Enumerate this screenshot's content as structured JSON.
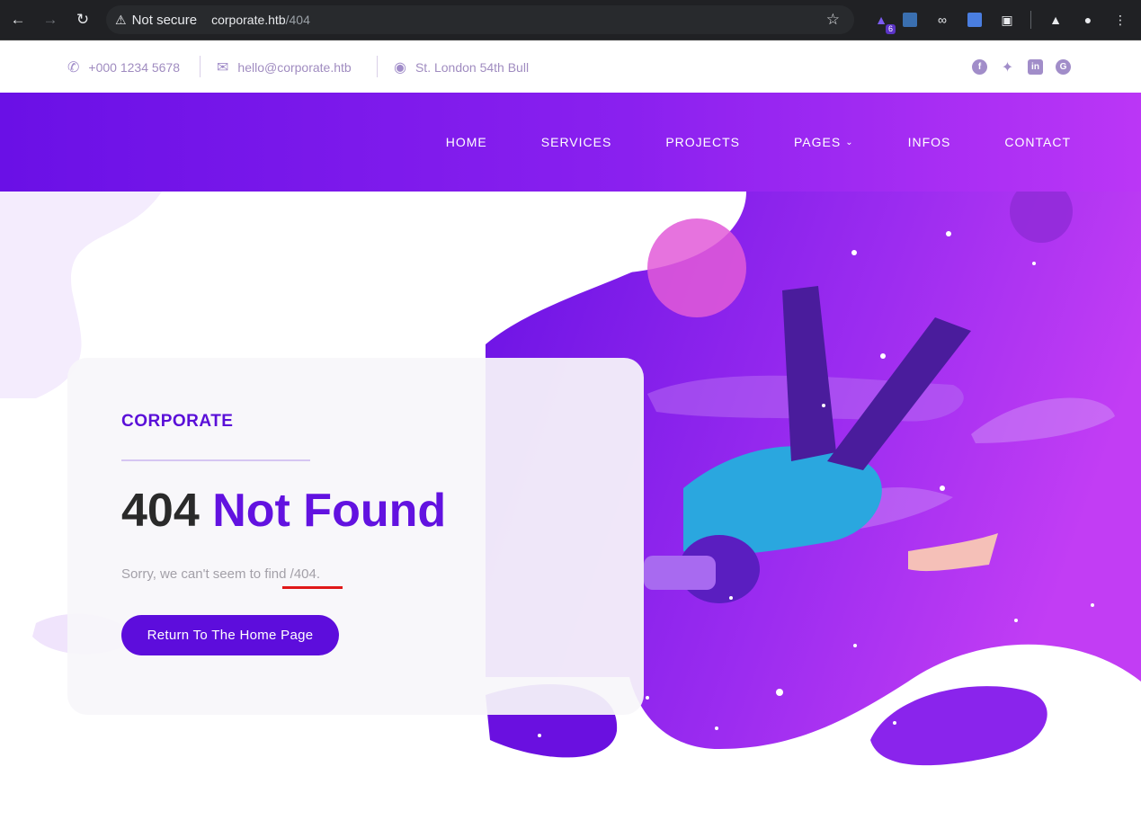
{
  "browser": {
    "security": "Not secure",
    "url_host": "corporate.htb",
    "url_path": "/404",
    "extension_badge": "6"
  },
  "topbar": {
    "phone": "+000 1234 5678",
    "email": "hello@corporate.htb",
    "address": "St. London 54th Bull",
    "social": [
      "facebook-icon",
      "twitter-icon",
      "linkedin-icon",
      "google-plus-icon"
    ]
  },
  "nav": {
    "items": [
      {
        "label": "HOME"
      },
      {
        "label": "SERVICES"
      },
      {
        "label": "PROJECTS"
      },
      {
        "label": "PAGES"
      },
      {
        "label": "INFOS"
      },
      {
        "label": "CONTACT"
      }
    ]
  },
  "error": {
    "brand": "CORPORATE",
    "code": "404",
    "title": "Not Found",
    "message": "Sorry, we can't seem to find /404.",
    "button": "Return To The Home Page"
  },
  "colors": {
    "accent": "#6212e0",
    "nav_gradient_start": "#6a10e6",
    "nav_gradient_end": "#bb36f6"
  }
}
